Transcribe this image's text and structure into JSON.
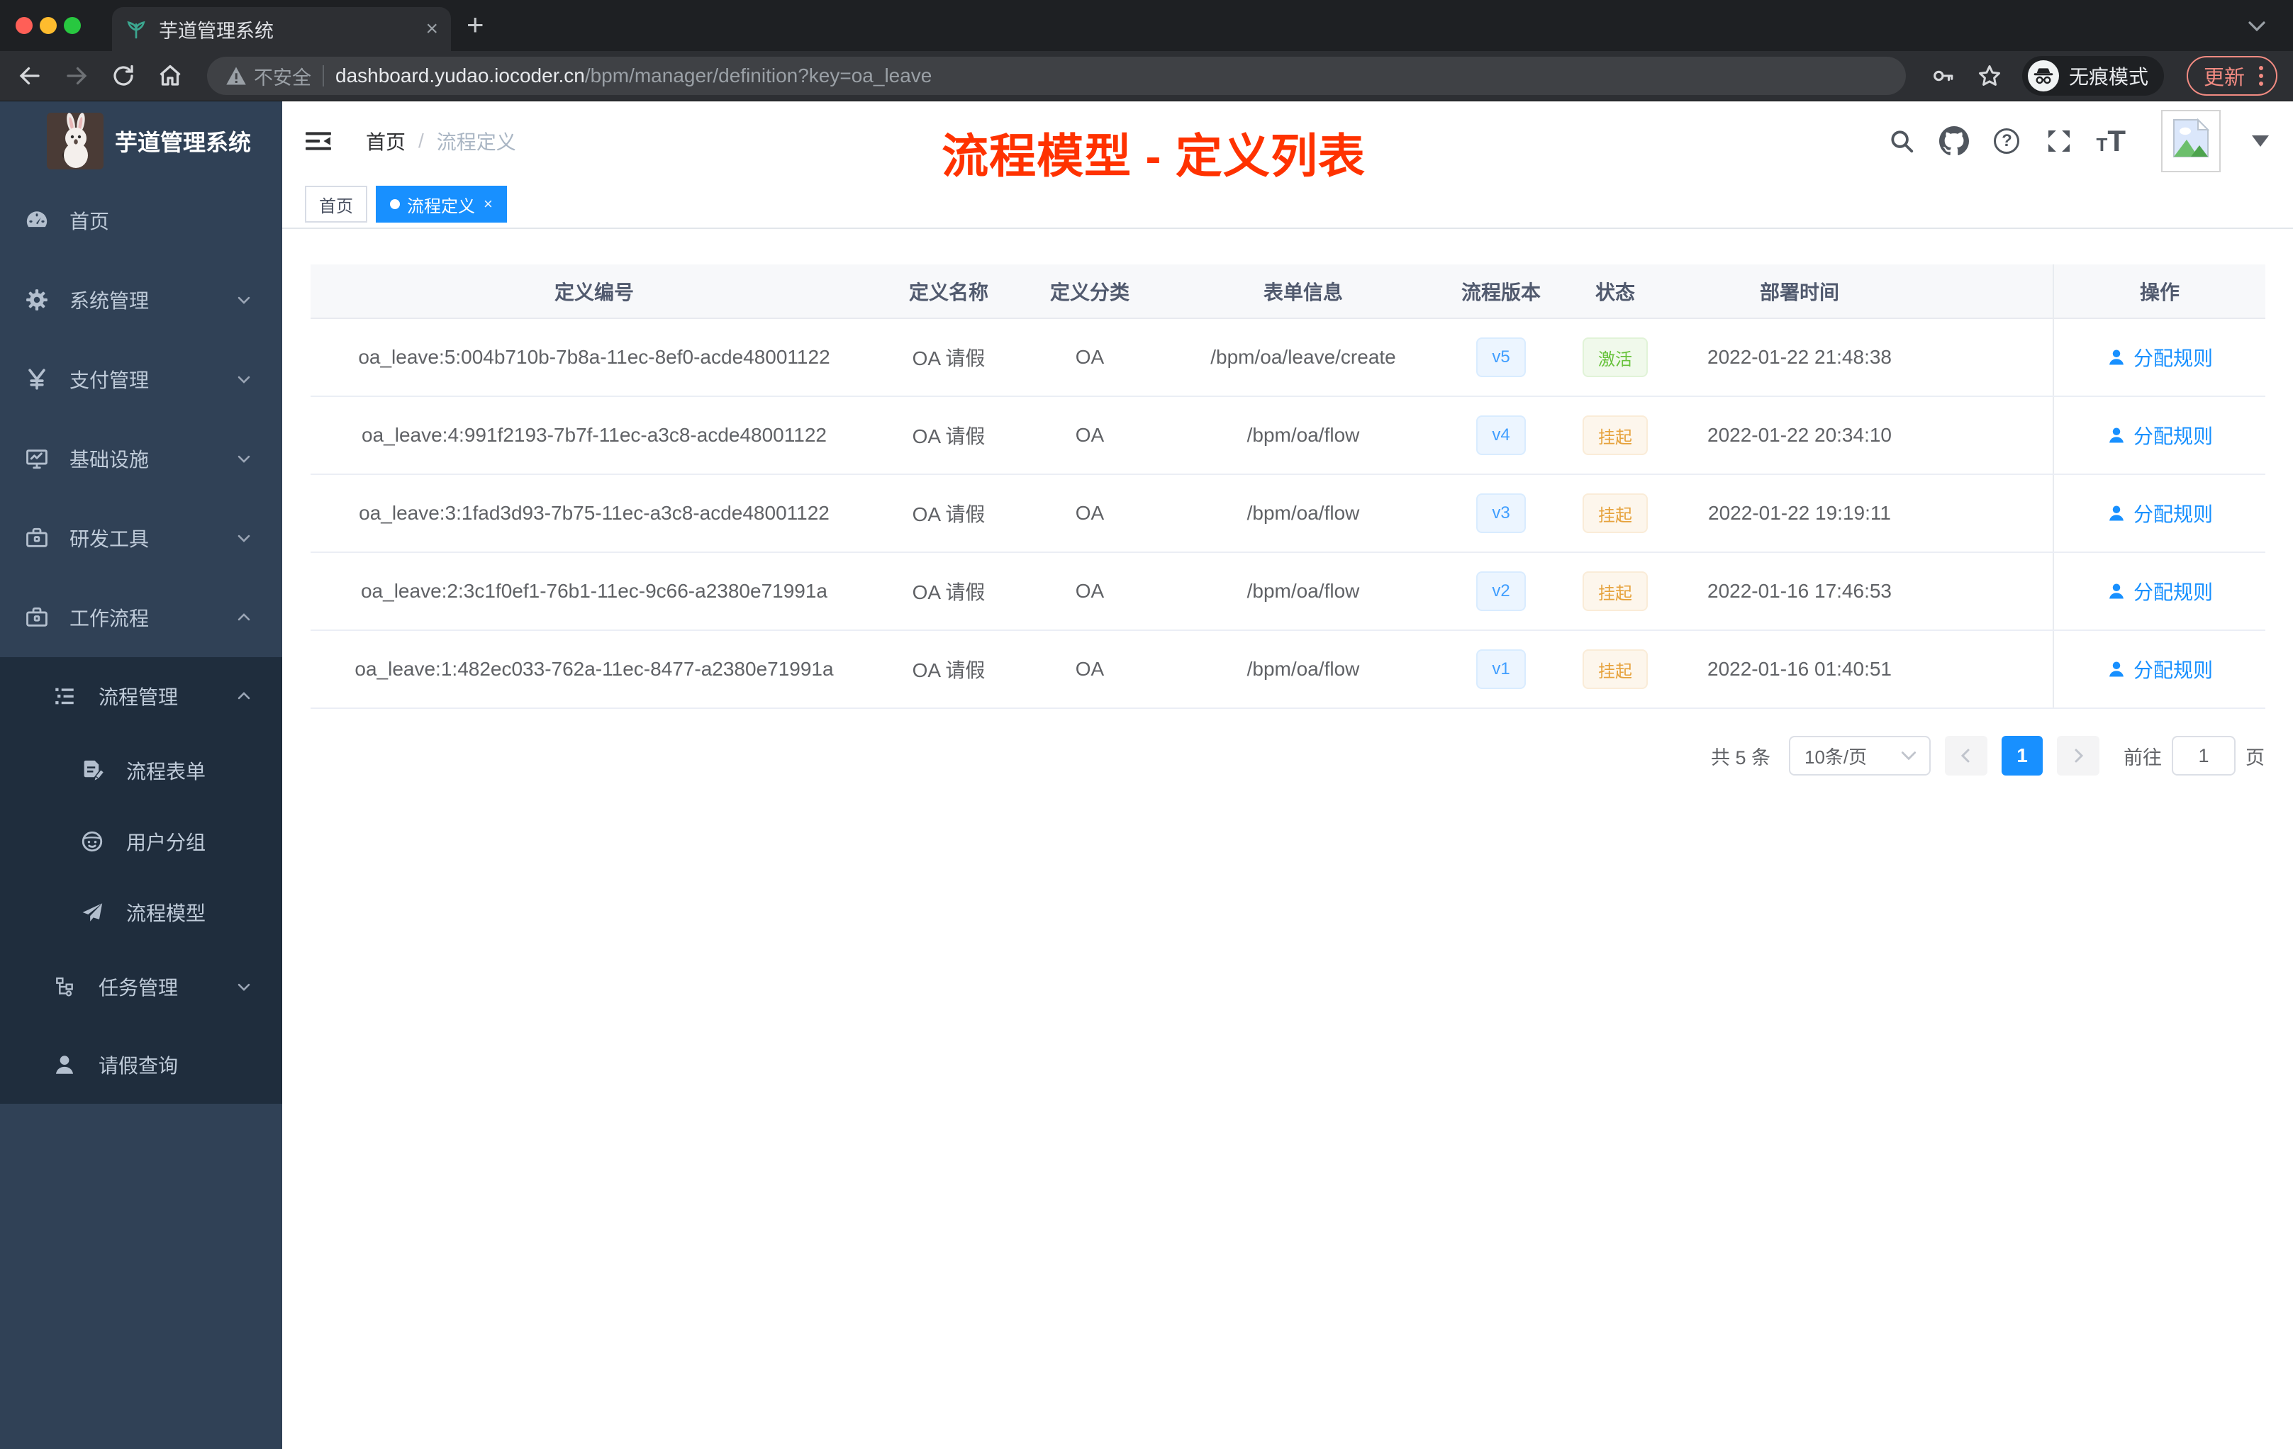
{
  "browser": {
    "tab_title": "芋道管理系统",
    "security_label": "不安全",
    "url_host": "dashboard.yudao.iocoder.cn",
    "url_path": "/bpm/manager/definition?key=oa_leave",
    "incognito_label": "无痕模式",
    "update_label": "更新"
  },
  "sidebar": {
    "app_title": "芋道管理系统",
    "items": [
      {
        "label": "首页",
        "icon": "dashboard-icon",
        "level": 1,
        "arrow": "",
        "dark": false
      },
      {
        "label": "系统管理",
        "icon": "gear-icon",
        "level": 1,
        "arrow": "down",
        "dark": false
      },
      {
        "label": "支付管理",
        "icon": "yen-icon",
        "level": 1,
        "arrow": "down",
        "dark": false
      },
      {
        "label": "基础设施",
        "icon": "monitor-icon",
        "level": 1,
        "arrow": "down",
        "dark": false
      },
      {
        "label": "研发工具",
        "icon": "toolbox-icon",
        "level": 1,
        "arrow": "down",
        "dark": false
      },
      {
        "label": "工作流程",
        "icon": "briefcase-icon",
        "level": 1,
        "arrow": "up",
        "dark": false
      },
      {
        "label": "流程管理",
        "icon": "tree-list-icon",
        "level": 2,
        "arrow": "up",
        "dark": true
      },
      {
        "label": "流程表单",
        "icon": "form-doc-icon",
        "level": 3,
        "arrow": "",
        "dark": true
      },
      {
        "label": "用户分组",
        "icon": "user-group-icon",
        "level": 3,
        "arrow": "",
        "dark": true
      },
      {
        "label": "流程模型",
        "icon": "paper-plane-icon",
        "level": 3,
        "arrow": "",
        "dark": true
      },
      {
        "label": "任务管理",
        "icon": "org-tree-icon",
        "level": 2,
        "arrow": "down",
        "dark": true
      },
      {
        "label": "请假查询",
        "icon": "person-icon",
        "level": 2,
        "arrow": "",
        "dark": true
      }
    ]
  },
  "navbar": {
    "breadcrumb": [
      "首页",
      "流程定义"
    ],
    "annotation": "流程模型 - 定义列表"
  },
  "tags": [
    {
      "label": "首页",
      "active": false
    },
    {
      "label": "流程定义",
      "active": true
    }
  ],
  "table": {
    "columns": [
      "定义编号",
      "定义名称",
      "定义分类",
      "表单信息",
      "流程版本",
      "状态",
      "部署时间",
      "操作"
    ],
    "action_label": "分配规则",
    "rows": [
      {
        "id": "oa_leave:5:004b710b-7b8a-11ec-8ef0-acde48001122",
        "name": "OA 请假",
        "category": "OA",
        "form": "/bpm/oa/leave/create",
        "version": "v5",
        "status": "激活",
        "status_type": "success",
        "deploy_time": "2022-01-22 21:48:38"
      },
      {
        "id": "oa_leave:4:991f2193-7b7f-11ec-a3c8-acde48001122",
        "name": "OA 请假",
        "category": "OA",
        "form": "/bpm/oa/flow",
        "version": "v4",
        "status": "挂起",
        "status_type": "warning",
        "deploy_time": "2022-01-22 20:34:10"
      },
      {
        "id": "oa_leave:3:1fad3d93-7b75-11ec-a3c8-acde48001122",
        "name": "OA 请假",
        "category": "OA",
        "form": "/bpm/oa/flow",
        "version": "v3",
        "status": "挂起",
        "status_type": "warning",
        "deploy_time": "2022-01-22 19:19:11"
      },
      {
        "id": "oa_leave:2:3c1f0ef1-76b1-11ec-9c66-a2380e71991a",
        "name": "OA 请假",
        "category": "OA",
        "form": "/bpm/oa/flow",
        "version": "v2",
        "status": "挂起",
        "status_type": "warning",
        "deploy_time": "2022-01-16 17:46:53"
      },
      {
        "id": "oa_leave:1:482ec033-762a-11ec-8477-a2380e71991a",
        "name": "OA 请假",
        "category": "OA",
        "form": "/bpm/oa/flow",
        "version": "v1",
        "status": "挂起",
        "status_type": "warning",
        "deploy_time": "2022-01-16 01:40:51"
      }
    ]
  },
  "pagination": {
    "total_label": "共 5 条",
    "page_size": "10条/页",
    "current_page": "1",
    "goto_label": "前往",
    "goto_value": "1",
    "page_unit": "页"
  },
  "colors": {
    "accent": "#1890ff",
    "sidebar_bg": "#304156",
    "submenu_bg": "#1f2d3d",
    "annotation_red": "#ff3200",
    "tag_success_text": "#67c23a",
    "tag_warning_text": "#e6a23c",
    "tag_version_text": "#409eff"
  }
}
